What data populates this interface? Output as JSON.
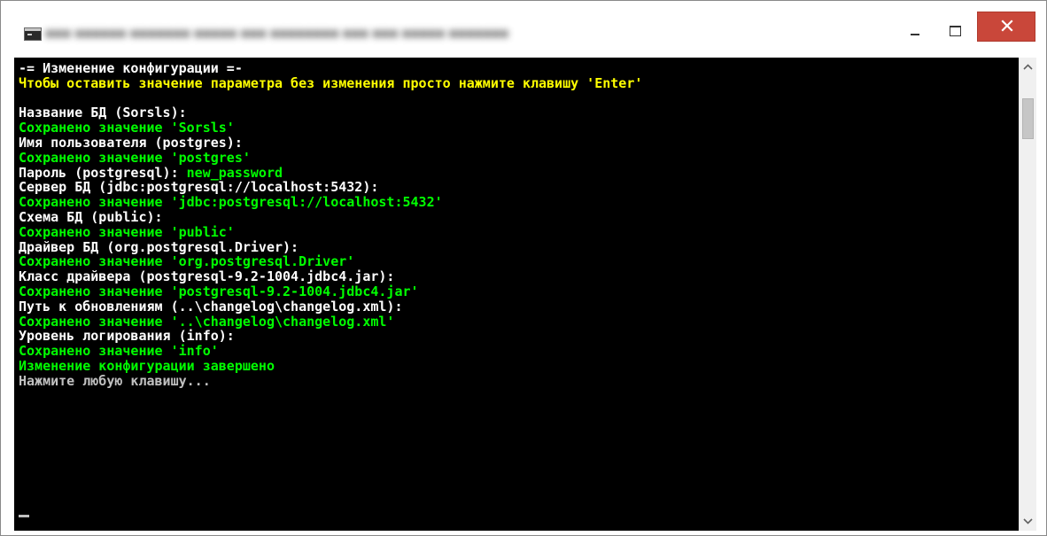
{
  "window": {
    "title": "■■■ ■■■■■■ ■■■■■■■ ■■■■■ ■■■ ■■■■■■■■ ■■■ ■■■ ■■■■■ ■■■■■■■",
    "buttons": {
      "minimize": "minimize",
      "maximize": "maximize",
      "close": "close"
    }
  },
  "colors": {
    "console_background": "#000000",
    "text_white": "#ffffff",
    "text_yellow": "#ffff00",
    "text_green": "#00ff00",
    "text_gray": "#c0c0c0",
    "close_button": "#c9473a"
  },
  "console": {
    "lines": [
      {
        "text": "-= Изменение конфигурации =-",
        "color": "white"
      },
      {
        "text": "Чтобы оставить значение параметра без изменения просто нажмите клавишу 'Enter'",
        "color": "yellow"
      },
      {
        "text": "",
        "color": "white"
      },
      {
        "text": "Название БД (Sorsls):",
        "color": "white"
      },
      {
        "text": "Сохранено значение 'Sorsls'",
        "color": "green"
      },
      {
        "text": "Имя пользователя (postgres):",
        "color": "white"
      },
      {
        "text": "Сохранено значение 'postgres'",
        "color": "green"
      },
      {
        "segments": [
          {
            "text": "Пароль (postgresql): ",
            "color": "white"
          },
          {
            "text": "new_password",
            "color": "green"
          }
        ]
      },
      {
        "text": "Сервер БД (jdbc:postgresql://localhost:5432):",
        "color": "white"
      },
      {
        "text": "Сохранено значение 'jdbc:postgresql://localhost:5432'",
        "color": "green"
      },
      {
        "text": "Схема БД (public):",
        "color": "white"
      },
      {
        "text": "Сохранено значение 'public'",
        "color": "green"
      },
      {
        "text": "Драйвер БД (org.postgresql.Driver):",
        "color": "white"
      },
      {
        "text": "Сохранено значение 'org.postgresql.Driver'",
        "color": "green"
      },
      {
        "text": "Класс драйвера (postgresql-9.2-1004.jdbc4.jar):",
        "color": "white"
      },
      {
        "text": "Сохранено значение 'postgresql-9.2-1004.jdbc4.jar'",
        "color": "green"
      },
      {
        "text": "Путь к обновлениям (..\\changelog\\changelog.xml):",
        "color": "white"
      },
      {
        "text": "Сохранено значение '..\\changelog\\changelog.xml'",
        "color": "green"
      },
      {
        "text": "Уровень логирования (info):",
        "color": "white"
      },
      {
        "text": "Сохранено значение 'info'",
        "color": "green"
      },
      {
        "text": "Изменение конфигурации завершено",
        "color": "green"
      },
      {
        "text": "Нажмите любую клавишу...",
        "color": "gray"
      }
    ]
  },
  "scrollbar": {
    "up_icon": "chevron-up-icon",
    "down_icon": "chevron-down-icon",
    "position": 0
  }
}
